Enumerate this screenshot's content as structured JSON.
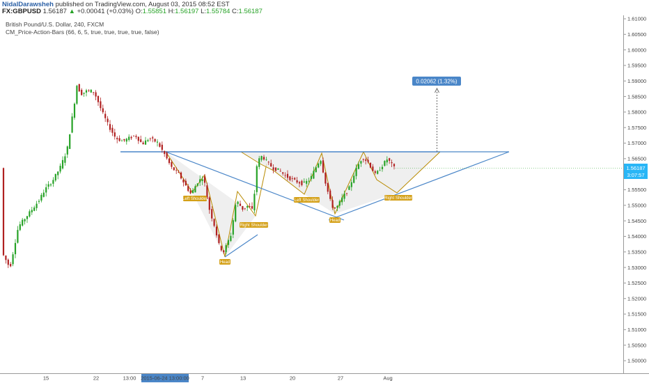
{
  "header": {
    "author": "NidalDarawsheh",
    "published": "published on TradingView.com, August 03, 2015 08:52 EST",
    "symbol": "FX:GBPUSD",
    "last": "1.56187",
    "change_icon": "up-triangle-icon",
    "change": "+0.00041 (+0.03%)",
    "o_label": "O:",
    "o_value": "1.55851",
    "h_label": "H:",
    "h_value": "1.56197",
    "l_label": "L:",
    "l_value": "1.55784",
    "c_label": "C:",
    "c_value": "1.56187"
  },
  "chart_data": {
    "type": "candlestick",
    "title": "British Pound/U.S. Dollar, 240, FXCM",
    "indicator": "CM_Price-Action-Bars (66, 6, 5, true, true, true, true, false)",
    "y_ticks": [
      "1.61000",
      "1.60500",
      "1.60000",
      "1.59500",
      "1.59000",
      "1.58500",
      "1.58000",
      "1.57500",
      "1.57000",
      "1.56500",
      "1.56000",
      "1.55500",
      "1.55000",
      "1.54500",
      "1.54000",
      "1.53500",
      "1.53000",
      "1.52500",
      "1.52000",
      "1.51500",
      "1.51000",
      "1.50500",
      "1.50000"
    ],
    "x_ticks": [
      "15",
      "22",
      "13:00",
      "2015-06-24 13:00:00",
      "7",
      "13",
      "20",
      "27",
      "Aug"
    ],
    "ylim": [
      1.4965,
      1.6125
    ],
    "price_label": "1.56187",
    "countdown_label": "3:07:57",
    "measure_label": "0.02062 (1.32%)",
    "pattern_labels": [
      "Left Shoulder",
      "Head",
      "Right Shoulder",
      "Left Shoulder",
      "Head",
      "Right Shoulder"
    ],
    "colors": {
      "up": "#26a226",
      "down": "#b02020",
      "neckline": "#4a86c8",
      "pattern": "#b88a00",
      "label_bg": "#d4a017",
      "price_box": "#29b6f6"
    },
    "grid": false
  }
}
